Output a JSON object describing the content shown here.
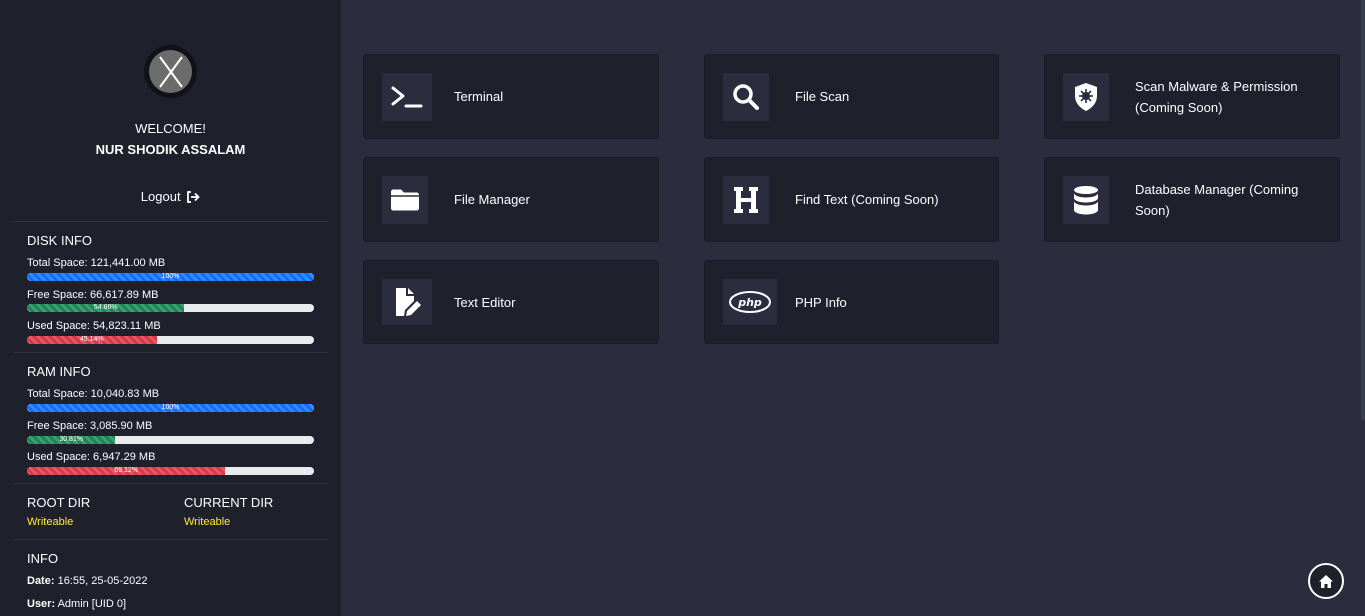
{
  "profile": {
    "welcome": "WELCOME!",
    "name": "NUR SHODIK ASSALAM",
    "logout": "Logout"
  },
  "disk": {
    "title": "DISK INFO",
    "total_label": "Total Space: 121,441.00 MB",
    "total_pct_text": "100%",
    "total_pct": 100,
    "free_label": "Free Space: 66,617.89 MB",
    "free_pct_text": "54.86%",
    "free_pct": 54.86,
    "used_label": "Used Space: 54,823.11 MB",
    "used_pct_text": "45.14%",
    "used_pct": 45.14
  },
  "ram": {
    "title": "RAM INFO",
    "total_label": "Total Space: 10,040.83 MB",
    "total_pct_text": "100%",
    "total_pct": 100,
    "free_label": "Free Space: 3,085.90 MB",
    "free_pct_text": "30.81%",
    "free_pct": 30.81,
    "used_label": "Used Space: 6,947.29 MB",
    "used_pct_text": "69.12%",
    "used_pct": 69.12
  },
  "dirs": {
    "root_title": "ROOT DIR",
    "root_status": "Writeable",
    "current_title": "CURRENT DIR",
    "current_status": "Writeable"
  },
  "info": {
    "title": "INFO",
    "date_key": "Date:",
    "date_val": " 16:55, 25-05-2022",
    "user_key": "User:",
    "user_val": " Admin [UID 0]"
  },
  "tiles": {
    "terminal": "Terminal",
    "file_scan": "File Scan",
    "scan_malware": "Scan Malware & Permission (Coming Soon)",
    "file_manager": "File Manager",
    "find_text": "Find Text (Coming Soon)",
    "database_manager": "Database Manager (Coming Soon)",
    "text_editor": "Text Editor",
    "php_info": "PHP Info"
  },
  "icons": {
    "terminal": "terminal-icon",
    "file_scan": "search-icon",
    "scan_malware": "shield-virus-icon",
    "file_manager": "folder-icon",
    "find_text": "heading-icon",
    "database_manager": "database-icon",
    "text_editor": "file-edit-icon",
    "php_info": "php-icon",
    "home": "home-icon",
    "logout": "sign-out-icon"
  },
  "colors": {
    "background": "#2b2d3e",
    "sidebar": "#1e202c",
    "tile": "#1e202c",
    "bar_total": "#0d6efd",
    "bar_free": "#198754",
    "bar_used": "#dc3545",
    "writeable": "#ffeb3b"
  }
}
